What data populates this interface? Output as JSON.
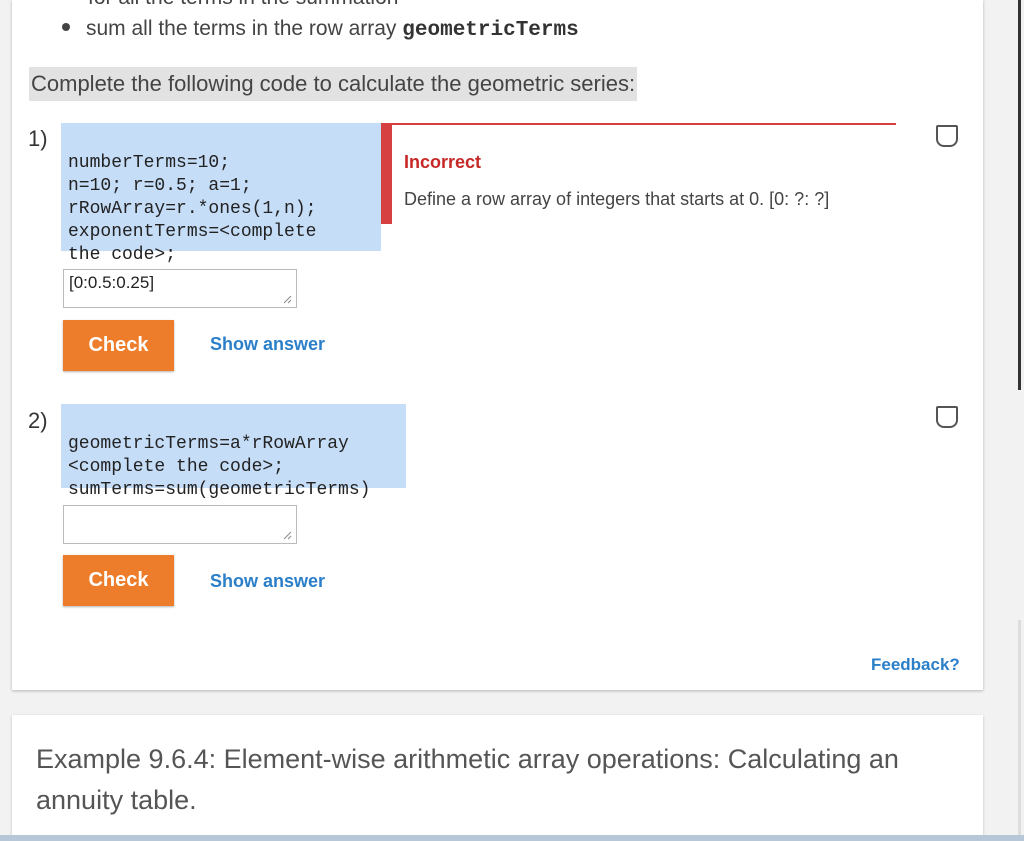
{
  "top": {
    "cut_text": "for all the terms in the summation",
    "bullet_prefix": "sum all the terms in the row array ",
    "bullet_code": "geometricTerms"
  },
  "instruction": "Complete the following code to calculate the geometric series:",
  "questions": [
    {
      "number": "1)",
      "code": [
        "numberTerms=10;",
        "n=10; r=0.5; a=1;",
        "rRowArray=r.*ones(1,n);",
        "exponentTerms=<complete",
        "the code>;"
      ],
      "input_value": "[0:0.5:0.25]",
      "check_label": "Check",
      "show_answer_label": "Show answer",
      "feedback": {
        "title": "Incorrect",
        "text": "Define a row array of integers that starts at 0. [0: ?: ?]",
        "color": "#d64040"
      }
    },
    {
      "number": "2)",
      "code": [
        "geometricTerms=a*rRowArray",
        "<complete the code>;",
        "sumTerms=sum(geometricTerms)"
      ],
      "input_value": "",
      "check_label": "Check",
      "show_answer_label": "Show answer"
    }
  ],
  "feedback_link": "Feedback?",
  "example_title": "Example 9.6.4: Element-wise arithmetic array operations: Calculating an annuity table.",
  "colors": {
    "check_button": "#ed7d2b",
    "link": "#2b7fc9",
    "code_bg": "#c6ddf8",
    "incorrect": "#c62828"
  }
}
